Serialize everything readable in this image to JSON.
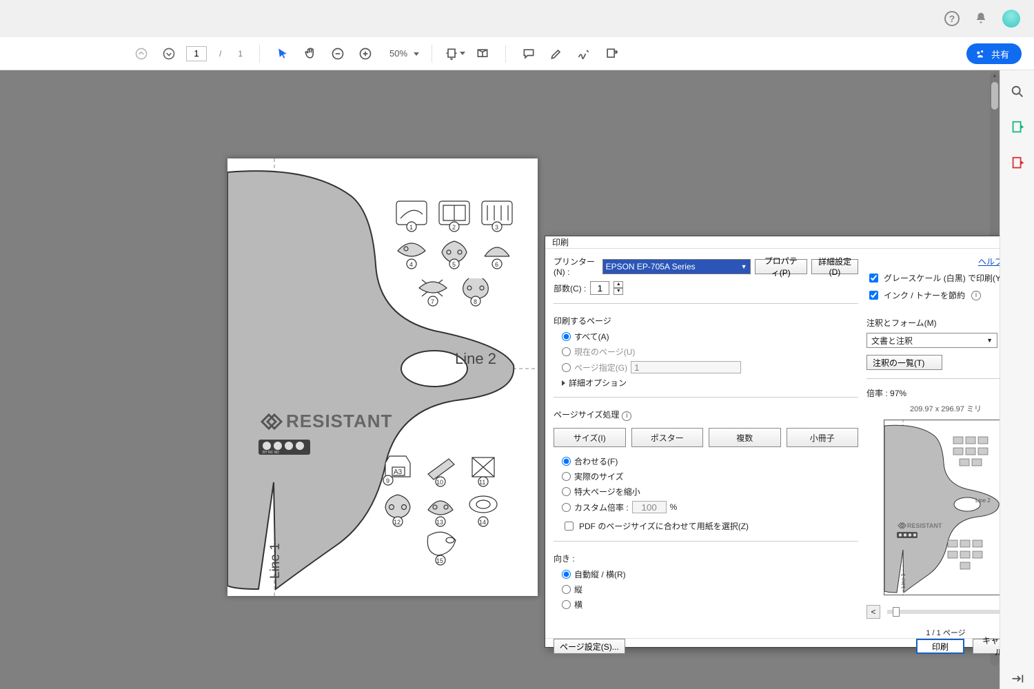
{
  "toolbar": {
    "page_current": "1",
    "page_total": "1",
    "zoom": "50%",
    "share_label": "共有"
  },
  "document": {
    "brand": "RESISTANT",
    "line1_label": "Line 1",
    "line2_label": "Line 2",
    "icon_a3": "A3"
  },
  "dialog": {
    "title": "印刷",
    "printer_label": "プリンター(N) :",
    "printer_value": "EPSON EP-705A Series",
    "properties_btn": "プロパティ(P)",
    "advanced_btn": "詳細設定(D)",
    "help_label": "ヘルプ(H)",
    "copies_label": "部数(C) :",
    "copies_value": "1",
    "grayscale_label": "グレースケール (白黒) で印刷(Y)",
    "savetoner_label": "インク / トナーを節約",
    "pages_group": "印刷するページ",
    "pages_all": "すべて(A)",
    "pages_current": "現在のページ(U)",
    "pages_range": "ページ指定(G)",
    "pages_range_value": "1",
    "more_options": "詳細オプション",
    "size_group": "ページサイズ処理",
    "tab_size": "サイズ(I)",
    "tab_poster": "ポスター",
    "tab_multiple": "複数",
    "tab_booklet": "小冊子",
    "fit": "合わせる(F)",
    "actual": "実際のサイズ",
    "shrink": "特大ページを縮小",
    "custom": "カスタム倍率 :",
    "custom_value": "100",
    "custom_unit": "%",
    "choose_paper": "PDF のページサイズに合わせて用紙を選択(Z)",
    "orient_label": "向き :",
    "orient_auto": "自動縦 / 横(R)",
    "orient_portrait": "縦",
    "orient_landscape": "横",
    "comments_group": "注釈とフォーム(M)",
    "comments_value": "文書と注釈",
    "comments_list_btn": "注釈の一覧(T)",
    "scale_label": "倍率 :",
    "scale_value": "97%",
    "paper_dims": "209.97 x 296.97 ミリ",
    "prev_line2": "Line 2",
    "prev_line1": "Line 1",
    "prev_brand": "RESISTANT",
    "page_counter": "1 / 1 ページ",
    "page_setup_btn": "ページ設定(S)...",
    "print_btn": "印刷",
    "cancel_btn": "キャンセル"
  }
}
